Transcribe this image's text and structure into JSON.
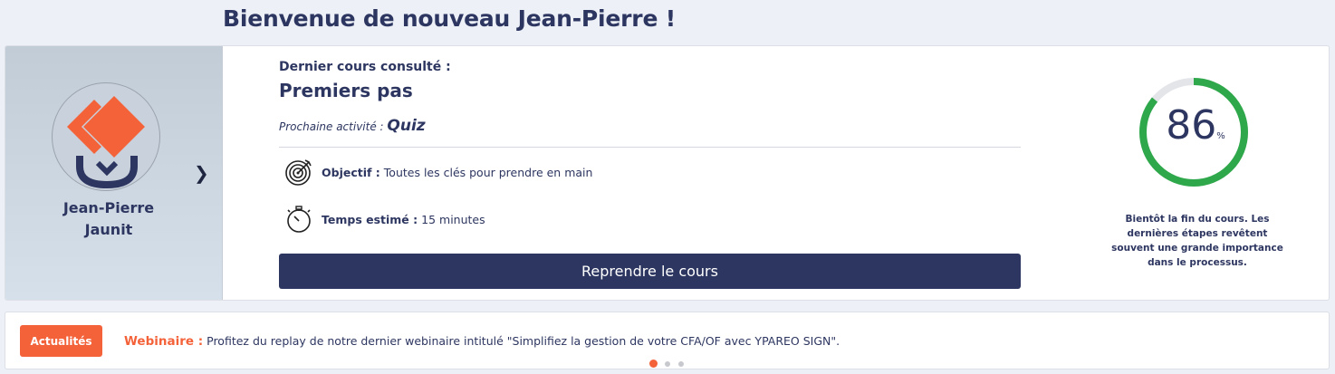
{
  "header": {
    "welcome": "Bienvenue de nouveau Jean-Pierre !"
  },
  "profile": {
    "first_name": "Jean-Pierre",
    "last_name": "Jaunit"
  },
  "course": {
    "last_label": "Dernier cours consulté :",
    "title": "Premiers pas",
    "next_activity_label": "Prochaine activité :",
    "next_activity": "Quiz",
    "objective_label": "Objectif :",
    "objective": "Toutes les clés pour prendre en main",
    "time_label": "Temps estimé :",
    "time": "15 minutes",
    "resume_button": "Reprendre le cours"
  },
  "progress": {
    "value": 86,
    "unit": "%",
    "message": "Bientôt la fin du cours. Les dernières étapes revêtent souvent une grande importance dans le processus.",
    "color": "#2ea84a",
    "track_color": "#e3e5e9"
  },
  "news": {
    "badge": "Actualités",
    "keyword": "Webinaire :",
    "text": "Profitez du replay de notre dernier webinaire intitulé \"Simplifiez la gestion de votre CFA/OF avec YPAREO SIGN\".",
    "pages": 3,
    "active_page": 1
  },
  "colors": {
    "navy": "#2d3660",
    "accent": "#f4623a"
  },
  "icons": {
    "target": "target-icon",
    "timer": "stopwatch-icon",
    "chevron": "chevron-right-icon"
  }
}
